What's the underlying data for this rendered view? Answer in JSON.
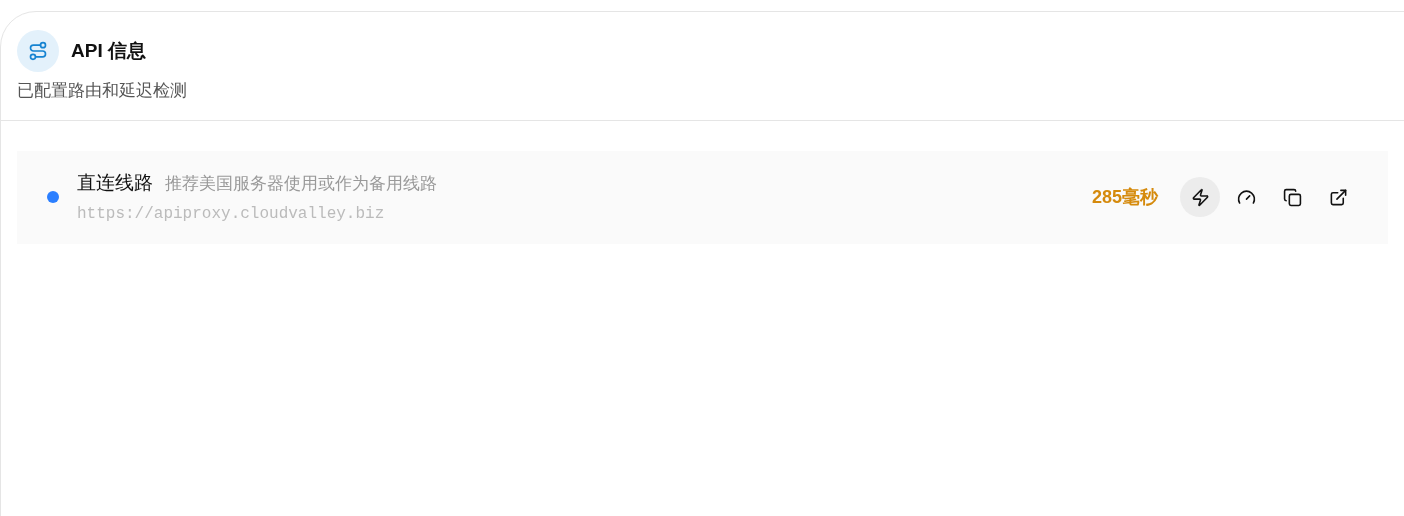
{
  "header": {
    "title": "API 信息",
    "subtitle": "已配置路由和延迟检测"
  },
  "routes": [
    {
      "name": "直连线路",
      "description": "推荐美国服务器使用或作为备用线路",
      "url": "https://apiproxy.cloudvalley.biz",
      "color": "#2b7fff",
      "latency": "285毫秒",
      "actions": [
        {
          "kind": "zap",
          "selected": true
        },
        {
          "kind": "gauge",
          "selected": false
        },
        {
          "kind": "copy",
          "selected": false
        },
        {
          "kind": "external",
          "selected": false
        }
      ]
    }
  ]
}
